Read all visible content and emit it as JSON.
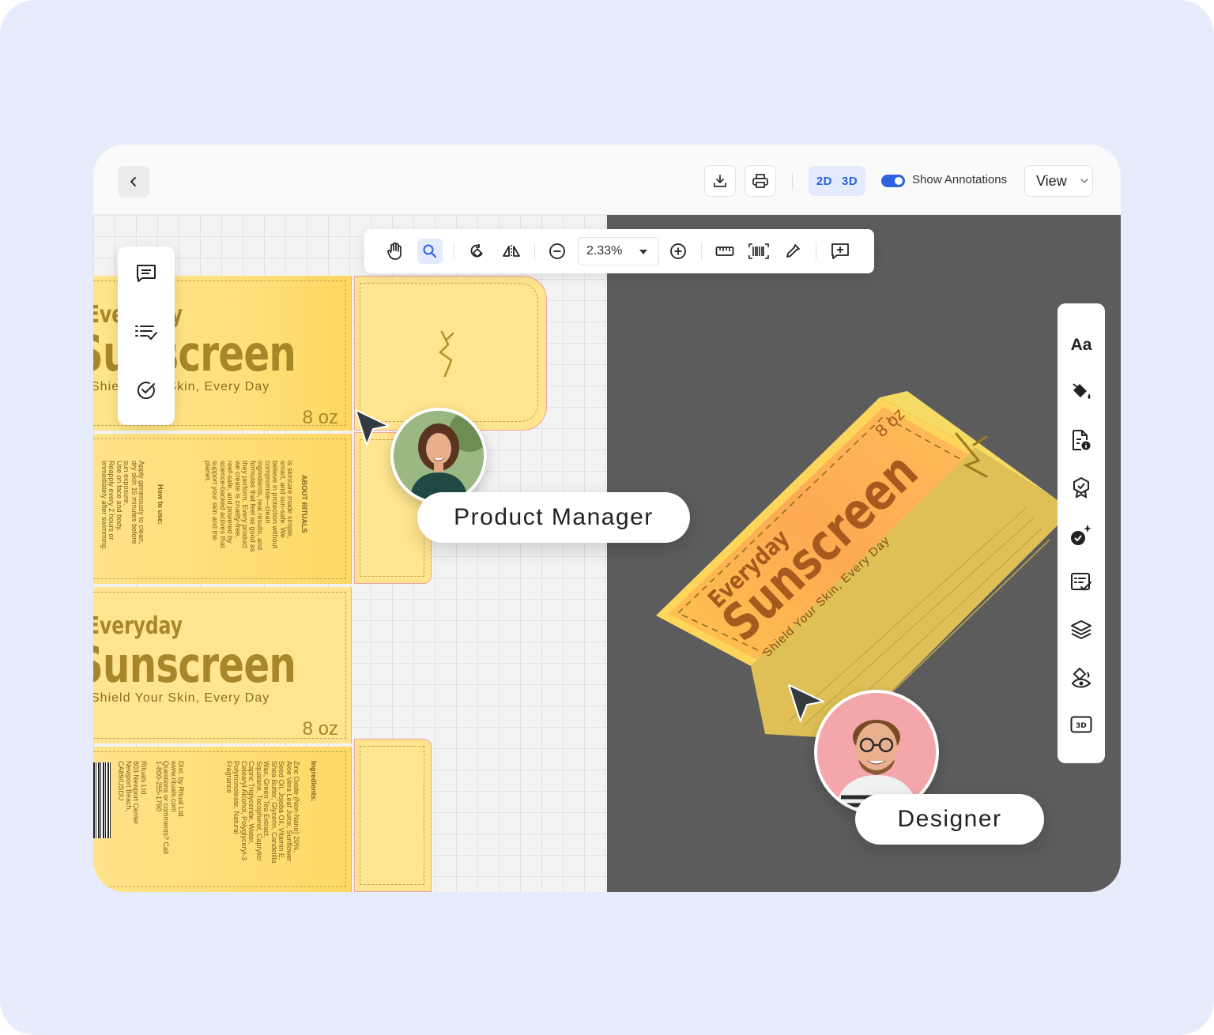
{
  "toolbar_top": {
    "mode_2d": "2D",
    "mode_3d": "3D",
    "annotations_label": "Show Annotations",
    "view_label": "View"
  },
  "canvas_toolbar": {
    "zoom_value": "2.33%"
  },
  "package": {
    "title_small": "Everyday",
    "title_big": "Sunscreen",
    "tagline": "Shield Your Skin, Every Day",
    "size": "8 oz",
    "about_heading": "ABOUT RITUALS",
    "about_lines": [
      "is skincare made simple,",
      "smart, and sun-safe. We",
      "believe in protection without",
      "compromise—clean",
      "ingredients, real results, and",
      "formulas that feel as good as",
      "they perform. Every product",
      "we create is cruelty-free,",
      "reef-safe, and powered by",
      "science-backed actives that",
      "support your skin and the",
      "planet."
    ],
    "howto_heading": "How to use:",
    "howto_lines": [
      "Apply generously to clean,",
      "dry skin 15 minutes before",
      "sun exposure.",
      "Use on face and body.",
      "Reapply every 2 hours or",
      "immediately after swimming."
    ],
    "ingredients_heading": "Ingredients:",
    "ingredients_lines": [
      "Zinc Oxide (Non-Nano) 20%,",
      "Aloe Vera Leaf Juice, Sunflower",
      "Seed Oil, Jojoba Oil, Vitamin E,",
      "Shea Butter, Glycerin, Candelilla",
      "Wax, Green Tea Extract,",
      "Squalane, Tocopherol, Caprylic/",
      "Capric Triglyceride, Water,",
      "Cetearyl Alcohol, Polyglyceryl-3",
      "Polyricinoleate, Natural",
      "Fragrance"
    ],
    "dist_lines": [
      "Dist. by Ritual Ltd.",
      "www.rituals.com",
      "Questions or comments? Call",
      "1-800-255-1790",
      "",
      "Rituals Ltd.",
      "803 Newport Center",
      "Newport Beach,",
      "CA89/USDU"
    ]
  },
  "collaborators": {
    "pm": "Product Manager",
    "designer": "Designer"
  },
  "colors": {
    "accent": "#2e62e0",
    "package_yellow": "#ffe58f",
    "package_orange": "#fdb24e",
    "dark_canvas": "#5c5c5c"
  },
  "icons": {
    "top": [
      "chevron-left-icon",
      "download-icon",
      "print-icon",
      "toggle-icon",
      "chevron-down-icon"
    ],
    "canvas": [
      "hand-icon",
      "search-icon",
      "rotate-icon",
      "flip-icon",
      "zoom-out-icon",
      "zoom-in-icon",
      "ruler-icon",
      "barcode-icon",
      "eyedropper-icon",
      "add-comment-icon"
    ],
    "left_rail": [
      "comment-icon",
      "checklist-icon",
      "check-circle-icon"
    ],
    "right_rail": [
      "text-icon",
      "paint-bucket-icon",
      "file-info-icon",
      "badge-icon",
      "magic-check-icon",
      "task-list-icon",
      "layers-icon",
      "eye-paint-icon",
      "3d-icon"
    ]
  }
}
